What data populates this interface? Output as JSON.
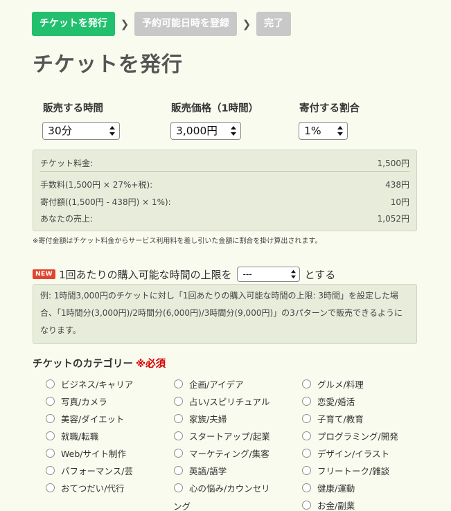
{
  "steps": [
    {
      "label": "チケットを発行"
    },
    {
      "label": "予約可能日時を登録"
    },
    {
      "label": "完了"
    }
  ],
  "page_title": "チケットを発行",
  "selects": {
    "time": {
      "label": "販売する時間",
      "value": "30分"
    },
    "price": {
      "label": "販売価格（1時間）",
      "value": "3,000円"
    },
    "donation": {
      "label": "寄付する割合",
      "value": "1%"
    }
  },
  "calc": {
    "ticket_fee": {
      "label": "チケット料金:",
      "value": "1,500円"
    },
    "commission": {
      "label": "手数料(1,500円 × 27%+税):",
      "value": "438円"
    },
    "donation": {
      "label": "寄付額((1,500円 - 438円) × 1%):",
      "value": "10円"
    },
    "sales": {
      "label": "あなたの売上:",
      "value": "1,052円"
    }
  },
  "note": "※寄付金額はチケット料金からサービス利用料を差し引いた金額に割合を掛け算出されます。",
  "limit": {
    "badge": "NEW",
    "prefix": "1回あたりの購入可能な時間の上限を",
    "select_value": "---",
    "suffix": "とする"
  },
  "example_text": "例: 1時間3,000円のチケットに対し「1回あたりの購入可能な時間の上限: 3時間」を設定した場合、「1時間分(3,000円)/2時間分(6,000円)/3時間分(9,000円)」の3パターンで販売できるようになります。",
  "category": {
    "title": "チケットのカテゴリー",
    "required": "※必須",
    "col1": [
      "ビジネス/キャリア",
      "写真/カメラ",
      "美容/ダイエット",
      "就職/転職",
      "Web/サイト制作",
      "パフォーマンス/芸",
      "おてつだい/代行"
    ],
    "col2": [
      "企画/アイデア",
      "占い/スピリチュアル",
      "家族/夫婦",
      "スタートアップ/起業",
      "マーケティング/集客",
      "英語/語学",
      "心の悩み/カウンセリ"
    ],
    "col2_wrap": "ング",
    "col3": [
      "グルメ/料理",
      "恋愛/婚活",
      "子育て/教育",
      "プログラミング/開発",
      "デザイン/イラスト",
      "フリートーク/雑談",
      "健康/運動",
      "お金/副業"
    ]
  }
}
